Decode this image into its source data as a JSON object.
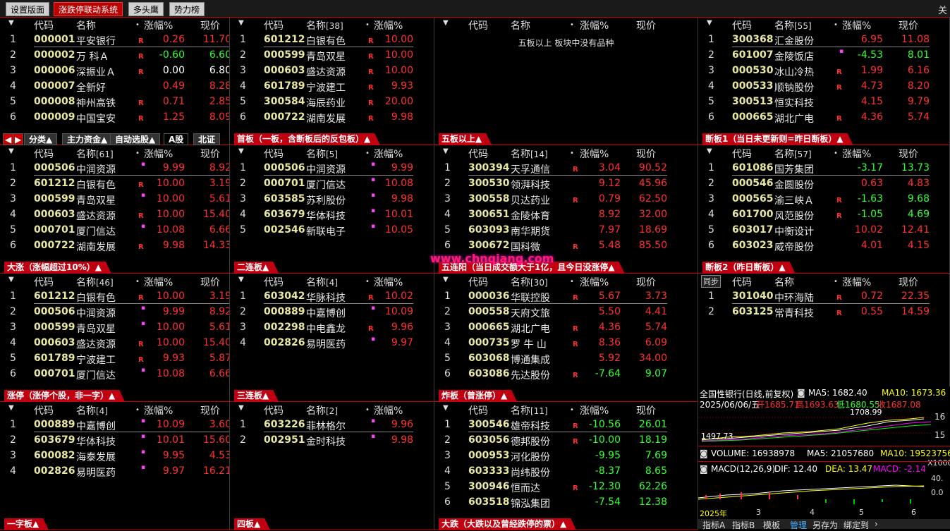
{
  "tabs": [
    "设置版面",
    "涨跌停联动系统",
    "多头鹰",
    "势力榜"
  ],
  "close_label": "关",
  "columns": {
    "code": "代码",
    "name": "名称",
    "chg": "涨幅%",
    "price": "现价"
  },
  "panels": [
    {
      "id": "p1",
      "name_hdr": "名称",
      "count": "",
      "price_col": true,
      "rows": [
        [
          "1",
          "000001",
          "平安银行",
          "R",
          "",
          "0.26",
          "red",
          "11.70",
          "red"
        ],
        [
          "2",
          "000002",
          "万 科Ａ",
          "R",
          "",
          "-0.60",
          "green",
          "6.60",
          "green"
        ],
        [
          "3",
          "000006",
          "深振业Ａ",
          "R",
          "",
          "0.00",
          "white",
          "6.80",
          "white"
        ],
        [
          "4",
          "000007",
          "全新好",
          "",
          "",
          "0.49",
          "red",
          "8.28",
          "red"
        ],
        [
          "5",
          "000008",
          "神州高铁",
          "R",
          "",
          "0.71",
          "red",
          "2.85",
          "red"
        ],
        [
          "6",
          "000009",
          "中国宝安",
          "R",
          "",
          "1.25",
          "red",
          "8.09",
          "red"
        ]
      ],
      "footer": "",
      "buttons": [
        "分类▲",
        "主力资金▲",
        "自动选股▲",
        "A股",
        "北证"
      ]
    },
    {
      "id": "p2",
      "name_hdr": "名称",
      "count": "[38]",
      "price_col": false,
      "rows": [
        [
          "1",
          "601212",
          "白银有色",
          "R",
          "",
          "10.00",
          "red",
          "",
          ""
        ],
        [
          "2",
          "000599",
          "青岛双星",
          "R",
          "",
          "10.00",
          "red",
          "",
          ""
        ],
        [
          "3",
          "000603",
          "盛达资源",
          "R",
          "",
          "10.00",
          "red",
          "",
          ""
        ],
        [
          "4",
          "601789",
          "宁波建工",
          "R",
          "",
          "9.93",
          "red",
          "",
          ""
        ],
        [
          "5",
          "300584",
          "海辰药业",
          "R",
          "",
          "20.00",
          "red",
          "",
          ""
        ],
        [
          "6",
          "000722",
          "湖南发展",
          "R",
          "",
          "9.98",
          "red",
          "",
          ""
        ]
      ],
      "footer": "首板（一板，含断板后的反包板）▲"
    },
    {
      "id": "p3",
      "name_hdr": "名称",
      "count": "",
      "price_col": true,
      "empty": "五板以上 板块中没有品种",
      "rows": [],
      "footer": "五板以上▲"
    },
    {
      "id": "p4",
      "name_hdr": "名称",
      "count": "[55]",
      "price_col": true,
      "rows": [
        [
          "1",
          "300368",
          "汇金股份",
          "",
          "",
          "6.95",
          "red",
          "11.08",
          "red"
        ],
        [
          "2",
          "601007",
          "金陵饭店",
          "",
          "m",
          "-4.53",
          "green",
          "8.01",
          "green"
        ],
        [
          "3",
          "000530",
          "冰山冷热",
          "R",
          "",
          "1.99",
          "red",
          "6.16",
          "red"
        ],
        [
          "4",
          "000533",
          "顺钠股份",
          "R",
          "",
          "4.73",
          "red",
          "8.20",
          "red"
        ],
        [
          "5",
          "300513",
          "恒实科技",
          "",
          "",
          "4.15",
          "red",
          "9.79",
          "red"
        ],
        [
          "6",
          "000665",
          "湖北广电",
          "R",
          "",
          "4.36",
          "red",
          "5.74",
          "red"
        ]
      ],
      "footer": "断板1（当日未更新则=昨日断板）▲"
    },
    {
      "id": "p5",
      "name_hdr": "名称",
      "count": "[61]",
      "price_col": true,
      "rows": [
        [
          "1",
          "000506",
          "中润资源",
          "",
          "m",
          "9.99",
          "red",
          "8.92",
          "red"
        ],
        [
          "2",
          "601212",
          "白银有色",
          "R",
          "",
          "10.00",
          "red",
          "3.19",
          "red"
        ],
        [
          "3",
          "000599",
          "青岛双星",
          "",
          "m",
          "10.00",
          "red",
          "5.61",
          "red"
        ],
        [
          "4",
          "000603",
          "盛达资源",
          "R",
          "",
          "10.00",
          "red",
          "15.40",
          "red"
        ],
        [
          "5",
          "000701",
          "厦门信达",
          "",
          "m",
          "10.08",
          "red",
          "6.66",
          "red"
        ],
        [
          "6",
          "000722",
          "湖南发展",
          "R",
          "",
          "9.98",
          "red",
          "14.33",
          "red"
        ]
      ],
      "footer": "大涨（涨幅超过10%）▲"
    },
    {
      "id": "p6",
      "name_hdr": "名称",
      "count": "[5]",
      "price_col": false,
      "rows": [
        [
          "1",
          "000506",
          "中润资源",
          "",
          "m",
          "9.99",
          "red",
          "",
          ""
        ],
        [
          "2",
          "000701",
          "厦门信达",
          "",
          "m",
          "10.08",
          "red",
          "",
          ""
        ],
        [
          "3",
          "603585",
          "苏利股份",
          "",
          "m",
          "9.98",
          "red",
          "",
          ""
        ],
        [
          "4",
          "603679",
          "华体科技",
          "",
          "m",
          "10.01",
          "red",
          "",
          ""
        ],
        [
          "5",
          "002546",
          "新联电子",
          "",
          "m",
          "10.05",
          "red",
          "",
          ""
        ]
      ],
      "footer": "二连板▲"
    },
    {
      "id": "p7",
      "name_hdr": "名称",
      "count": "[14]",
      "price_col": true,
      "rows": [
        [
          "1",
          "300394",
          "天孚通信",
          "R",
          "",
          "3.04",
          "red",
          "90.52",
          "red"
        ],
        [
          "2",
          "300530",
          "领湃科技",
          "",
          "",
          "9.12",
          "red",
          "45.96",
          "red"
        ],
        [
          "3",
          "300558",
          "贝达药业",
          "R",
          "",
          "0.79",
          "red",
          "62.50",
          "red"
        ],
        [
          "4",
          "300651",
          "金陵体育",
          "",
          "",
          "8.92",
          "red",
          "32.00",
          "red"
        ],
        [
          "5",
          "603093",
          "南华期货",
          "",
          "",
          "7.97",
          "red",
          "18.69",
          "red"
        ],
        [
          "6",
          "300672",
          "国科微",
          "R",
          "",
          "5.48",
          "red",
          "85.50",
          "red"
        ]
      ],
      "footer": "五连阳（当日成交额大于1亿，且今日没涨停▲"
    },
    {
      "id": "p8",
      "name_hdr": "名称",
      "count": "[57]",
      "price_col": true,
      "rows": [
        [
          "1",
          "601086",
          "国芳集团",
          "",
          "",
          "-3.17",
          "green",
          "13.73",
          "green"
        ],
        [
          "2",
          "000546",
          "金圆股份",
          "",
          "",
          "0.63",
          "red",
          "4.83",
          "red"
        ],
        [
          "3",
          "000565",
          "渝三峡Ａ",
          "R",
          "",
          "-1.63",
          "green",
          "9.68",
          "green"
        ],
        [
          "4",
          "601700",
          "风范股份",
          "R",
          "",
          "-1.05",
          "green",
          "4.69",
          "green"
        ],
        [
          "5",
          "603017",
          "中衡设计",
          "",
          "",
          "10.02",
          "red",
          "12.41",
          "red"
        ],
        [
          "6",
          "603023",
          "威帝股份",
          "",
          "",
          "4.01",
          "red",
          "4.15",
          "red"
        ]
      ],
      "footer": "断板2（昨日断板）▲"
    },
    {
      "id": "p9",
      "name_hdr": "名称",
      "count": "[46]",
      "price_col": true,
      "rows": [
        [
          "1",
          "601212",
          "白银有色",
          "R",
          "",
          "10.00",
          "red",
          "3.19",
          "red"
        ],
        [
          "2",
          "000506",
          "中润资源",
          "",
          "m",
          "9.99",
          "red",
          "8.92",
          "red"
        ],
        [
          "3",
          "000599",
          "青岛双星",
          "",
          "m",
          "10.00",
          "red",
          "5.61",
          "red"
        ],
        [
          "4",
          "000603",
          "盛达资源",
          "R",
          "",
          "10.00",
          "red",
          "15.40",
          "red"
        ],
        [
          "5",
          "601789",
          "宁波建工",
          "R",
          "",
          "9.93",
          "red",
          "5.87",
          "red"
        ],
        [
          "6",
          "000701",
          "厦门信达",
          "",
          "m",
          "10.08",
          "red",
          "6.66",
          "red"
        ]
      ],
      "footer": "涨停（涨停个股，非一字）▲"
    },
    {
      "id": "p10",
      "name_hdr": "名称",
      "count": "[4]",
      "price_col": false,
      "rows": [
        [
          "1",
          "603042",
          "华脉科技",
          "R",
          "",
          "10.02",
          "red",
          "",
          ""
        ],
        [
          "2",
          "000889",
          "中嘉博创",
          "",
          "m",
          "10.09",
          "red",
          "",
          ""
        ],
        [
          "3",
          "002298",
          "中电鑫龙",
          "R",
          "",
          "9.96",
          "red",
          "",
          ""
        ],
        [
          "4",
          "002826",
          "易明医药",
          "",
          "m",
          "9.97",
          "red",
          "",
          ""
        ]
      ],
      "footer": "三连板▲"
    },
    {
      "id": "p11",
      "name_hdr": "名称",
      "count": "[30]",
      "price_col": true,
      "rows": [
        [
          "1",
          "000036",
          "华联控股",
          "R",
          "",
          "5.67",
          "red",
          "3.73",
          "red"
        ],
        [
          "2",
          "000558",
          "天府文旅",
          "",
          "",
          "5.50",
          "red",
          "4.41",
          "red"
        ],
        [
          "3",
          "000665",
          "湖北广电",
          "R",
          "",
          "4.36",
          "red",
          "5.74",
          "red"
        ],
        [
          "4",
          "000735",
          "罗 牛 山",
          "R",
          "",
          "8.36",
          "red",
          "6.09",
          "red"
        ],
        [
          "5",
          "603068",
          "博通集成",
          "",
          "",
          "5.92",
          "red",
          "34.00",
          "red"
        ],
        [
          "6",
          "603086",
          "先达股份",
          "R",
          "",
          "-7.64",
          "green",
          "9.07",
          "green"
        ]
      ],
      "footer": "炸板（曾涨停）▲"
    },
    {
      "id": "p12",
      "name_hdr": "名称",
      "count": "",
      "price_col": true,
      "sync": "同步",
      "rows": [
        [
          "1",
          "301040",
          "中环海陆",
          "R",
          "",
          "0.72",
          "red",
          "22.35",
          "red"
        ],
        [
          "2",
          "603125",
          "常青科技",
          "R",
          "",
          "0.55",
          "red",
          "14.59",
          "red"
        ]
      ],
      "footer": "自选股"
    },
    {
      "id": "p13",
      "name_hdr": "名称",
      "count": "[4]",
      "price_col": true,
      "rows": [
        [
          "1",
          "000889",
          "中嘉博创",
          "",
          "m",
          "10.09",
          "red",
          "3.60",
          "red"
        ],
        [
          "2",
          "603679",
          "华体科技",
          "",
          "m",
          "10.01",
          "red",
          "15.60",
          "red"
        ],
        [
          "3",
          "600082",
          "海泰发展",
          "",
          "m",
          "9.95",
          "red",
          "4.53",
          "red"
        ],
        [
          "4",
          "002826",
          "易明医药",
          "",
          "m",
          "9.97",
          "red",
          "16.21",
          "red"
        ]
      ],
      "footer": "一字板▲"
    },
    {
      "id": "p14",
      "name_hdr": "名称",
      "count": "[2]",
      "price_col": false,
      "rows": [
        [
          "1",
          "603226",
          "菲林格尔",
          "",
          "m",
          "9.96",
          "red",
          "",
          ""
        ],
        [
          "2",
          "002951",
          "金时科技",
          "",
          "m",
          "9.98",
          "red",
          "",
          ""
        ]
      ],
      "footer": "四板▲"
    },
    {
      "id": "p15",
      "name_hdr": "名称",
      "count": "[11]",
      "price_col": true,
      "rows": [
        [
          "1",
          "300546",
          "雄帝科技",
          "R",
          "",
          "-10.56",
          "green",
          "26.01",
          "green"
        ],
        [
          "2",
          "603056",
          "德邦股份",
          "R",
          "",
          "-10.00",
          "green",
          "18.19",
          "green"
        ],
        [
          "3",
          "000953",
          "河化股份",
          "",
          "",
          "-9.95",
          "green",
          "7.69",
          "green"
        ],
        [
          "4",
          "603333",
          "尚纬股份",
          "",
          "",
          "-8.37",
          "green",
          "8.65",
          "green"
        ],
        [
          "5",
          "300946",
          "恒而达",
          "R",
          "",
          "-12.30",
          "green",
          "62.26",
          "green"
        ],
        [
          "6",
          "603518",
          "锦泓集团",
          "",
          "",
          "-7.54",
          "green",
          "12.38",
          "green"
        ]
      ],
      "footer": "大跌（大跌以及曾经跌停的票）▲"
    }
  ],
  "kline": {
    "title": "全国性银行(日线,前复权)",
    "ma5": "MA5: 1682.40",
    "ma10": "MA10: 1673.36",
    "date": "2025/06/06/五",
    "open": "开1685.71",
    "high": "高1693.63",
    "low": "低1680.55",
    "close": "收1687.08",
    "hi_mark": "1708.99",
    "lo_mark": "1497.73",
    "axis1": "16",
    "axis2": "15",
    "vol": "VOLUME: 16938978",
    "vma5": "MA5: 21057680",
    "vma10": "MA10: 19523756",
    "macd": "MACD(12,26,9)",
    "dif": "DIF: 12.40",
    "dea": "DEA: 13.47",
    "macdv": "MACD: -2.14",
    "x1000": "X1000",
    "m40": "40.",
    "m0": "0.0",
    "xlabels": [
      "2025年",
      "3",
      "4",
      "5",
      "6"
    ],
    "bottom_tabs": [
      "指标A",
      "指标B",
      "模板",
      "管理",
      "另存为",
      "绑定到"
    ]
  }
}
